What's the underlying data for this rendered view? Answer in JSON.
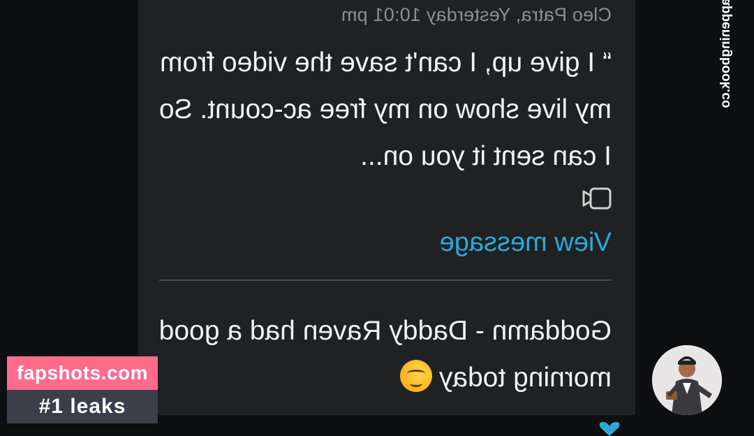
{
  "message": {
    "sender_time": "Cleo Patra, Yesterday 10:01 pm",
    "quote_text": "“ I give up, I can't save the video from my live show on my free ac-count. So I can sent it you on...",
    "attachment_icon": "video-camera-icon",
    "view_label": "View message"
  },
  "post": {
    "text": "Goddamn - Daddy Raven had a good morning today",
    "emoji": "smiling-drooling-face-emoji"
  },
  "avatar": {
    "icon": "cartoon-man-avatar"
  },
  "reaction": {
    "icon": "heart-icon",
    "color": "#2ea8d8"
  },
  "watermarks": {
    "site": "fapshots.com",
    "tagline": "#1 leaks",
    "side_text": "fappeningbook.co"
  },
  "colors": {
    "link": "#2ea8d8",
    "watermark_pink": "#ff6b8b",
    "watermark_dark": "#3b3f4a"
  }
}
